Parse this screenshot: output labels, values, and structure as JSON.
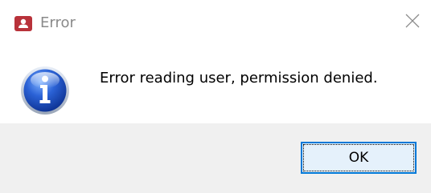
{
  "window": {
    "title": "Error",
    "app_icon": "user-id-card-icon",
    "close_icon": "close-icon"
  },
  "body": {
    "icon": "info-icon",
    "message": "Error reading user, permission denied."
  },
  "footer": {
    "ok_label": "OK"
  },
  "colors": {
    "app_icon": "#b8323a",
    "button_border": "#0078d7",
    "button_bg": "#e5f1fb",
    "footer_bg": "#f0f0f0",
    "title_text": "#8a8a8a"
  }
}
